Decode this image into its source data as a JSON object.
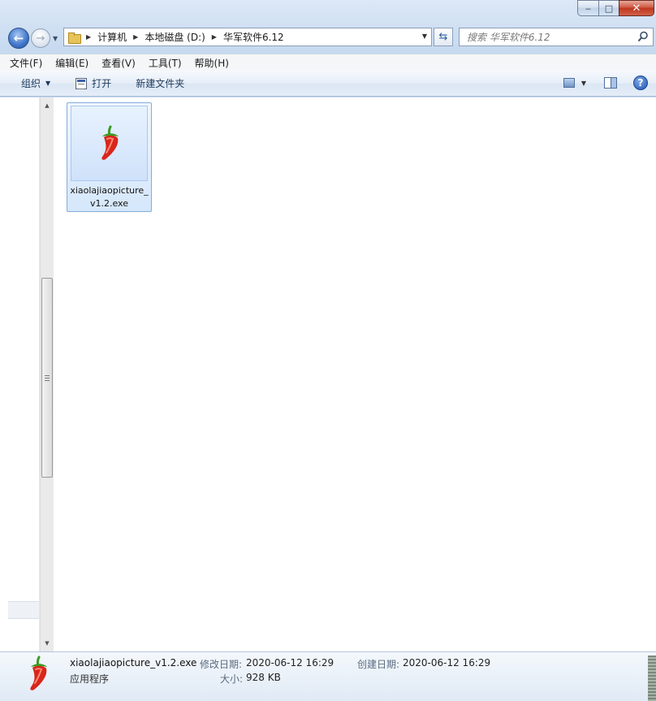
{
  "window": {
    "minimize_glyph": "‒",
    "maximize_glyph": "□",
    "close_glyph": "✕"
  },
  "address": {
    "crumbs": [
      "计算机",
      "本地磁盘 (D:)",
      "华军软件6.12"
    ]
  },
  "search": {
    "placeholder": "搜索 华军软件6.12"
  },
  "menubar": {
    "items": [
      "文件(F)",
      "编辑(E)",
      "查看(V)",
      "工具(T)",
      "帮助(H)"
    ]
  },
  "toolbar": {
    "organize_label": "组织",
    "open_label": "打开",
    "new_folder_label": "新建文件夹"
  },
  "files": [
    {
      "name": "xiaolajiaopicture_v1.2.exe",
      "icon": "chili-pepper-icon"
    }
  ],
  "details": {
    "name": "xiaolajiaopicture_v1.2.exe",
    "type": "应用程序",
    "modified_label": "修改日期:",
    "modified_value": "2020-06-12 16:29",
    "created_label": "创建日期:",
    "created_value": "2020-06-12 16:29",
    "size_label": "大小:",
    "size_value": "928 KB"
  },
  "colors": {
    "accent": "#3f75c9",
    "selection": "#d5e7fb",
    "pepper": "#d8261b",
    "stem": "#3a9a23"
  }
}
